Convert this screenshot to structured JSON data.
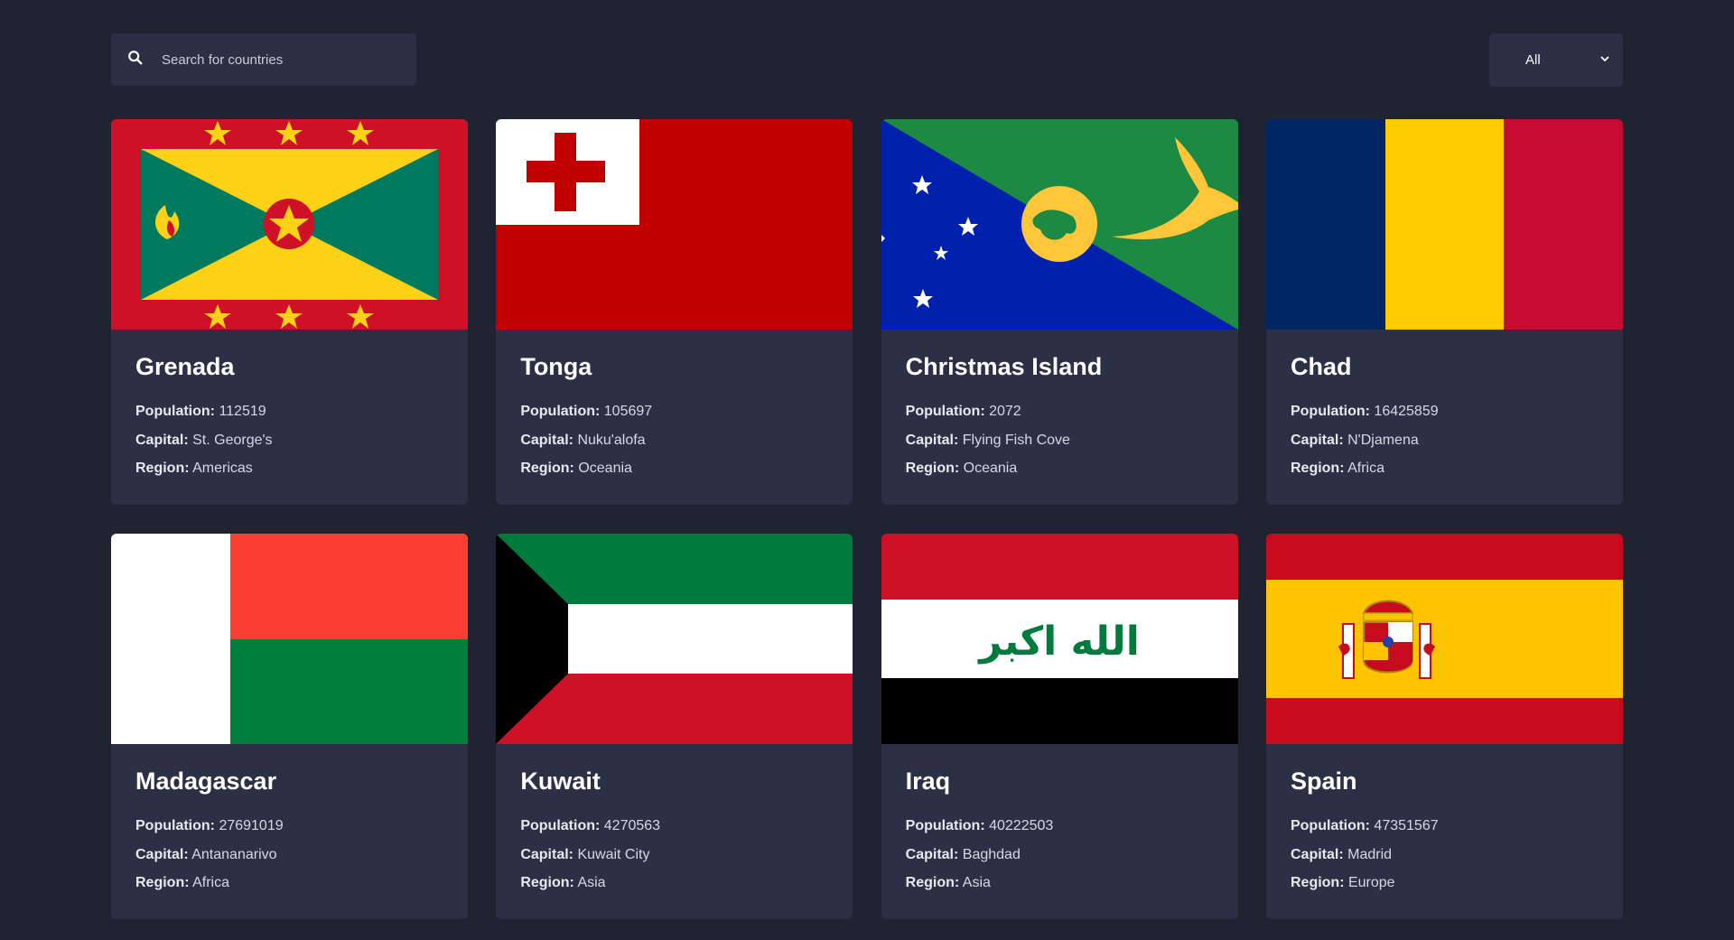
{
  "search": {
    "placeholder": "Search for countries"
  },
  "filter": {
    "selected": "All"
  },
  "labels": {
    "population": "Population:",
    "capital": "Capital:",
    "region": "Region:"
  },
  "countries": [
    {
      "name": "Grenada",
      "population": "112519",
      "capital": "St. George's",
      "region": "Americas",
      "flag": "grenada-flag"
    },
    {
      "name": "Tonga",
      "population": "105697",
      "capital": "Nuku'alofa",
      "region": "Oceania",
      "flag": "tonga-flag"
    },
    {
      "name": "Christmas Island",
      "population": "2072",
      "capital": "Flying Fish Cove",
      "region": "Oceania",
      "flag": "christmas-island-flag"
    },
    {
      "name": "Chad",
      "population": "16425859",
      "capital": "N'Djamena",
      "region": "Africa",
      "flag": "chad-flag"
    },
    {
      "name": "Madagascar",
      "population": "27691019",
      "capital": "Antananarivo",
      "region": "Africa",
      "flag": "madagascar-flag"
    },
    {
      "name": "Kuwait",
      "population": "4270563",
      "capital": "Kuwait City",
      "region": "Asia",
      "flag": "kuwait-flag"
    },
    {
      "name": "Iraq",
      "population": "40222503",
      "capital": "Baghdad",
      "region": "Asia",
      "flag": "iraq-flag",
      "flag_text": "الله اكبر"
    },
    {
      "name": "Spain",
      "population": "47351567",
      "capital": "Madrid",
      "region": "Europe",
      "flag": "spain-flag"
    }
  ],
  "colors": {
    "background": "#202331",
    "element": "#2b3045"
  }
}
